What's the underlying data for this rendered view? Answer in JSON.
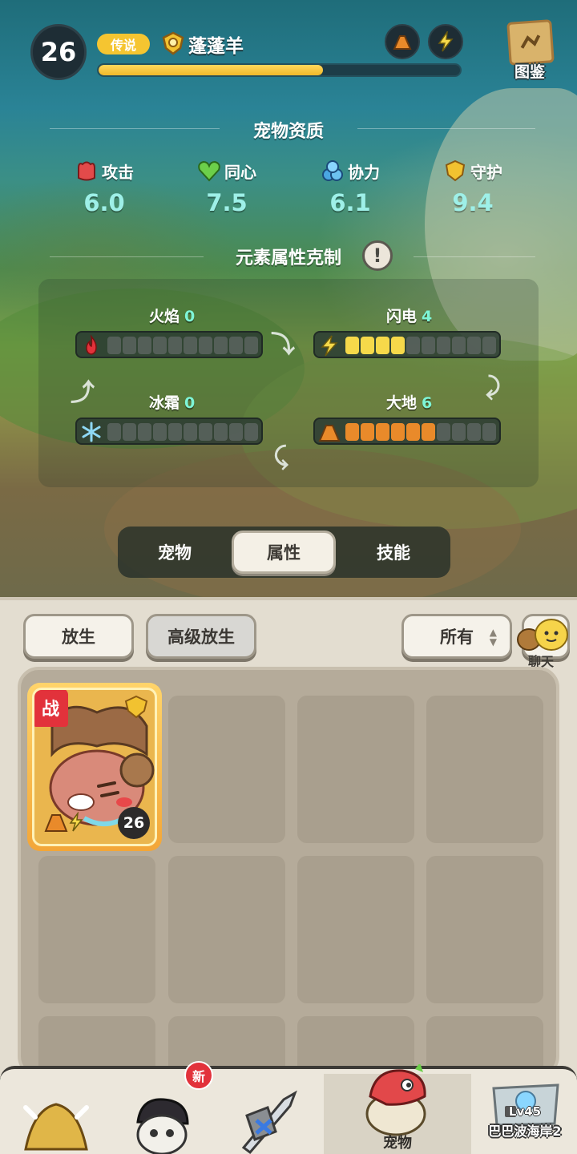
{
  "header": {
    "level": "26",
    "rarity": "传说",
    "pet_name": "蓬蓬羊",
    "exp_fraction": 0.62,
    "book_label": "图鉴",
    "element_icons": [
      "earth-icon",
      "lightning-icon"
    ]
  },
  "aptitude": {
    "title": "宠物资质",
    "stats": [
      {
        "label": "攻击",
        "value": "6.0",
        "icon": "attack-icon",
        "color": "#e24a4a"
      },
      {
        "label": "同心",
        "value": "7.5",
        "icon": "heart-icon",
        "color": "#6ccf4a"
      },
      {
        "label": "协力",
        "value": "6.1",
        "icon": "teamwork-icon",
        "color": "#4aa6e2"
      },
      {
        "label": "守护",
        "value": "9.4",
        "icon": "guard-icon",
        "color": "#f2c230"
      }
    ]
  },
  "elements": {
    "title": "元素属性克制",
    "items": [
      {
        "label": "火焰",
        "value": "0",
        "filled": 0,
        "total": 10,
        "color": "#e2323b",
        "icon": "fire-icon"
      },
      {
        "label": "闪电",
        "value": "4",
        "filled": 4,
        "total": 10,
        "color": "#f6d94a",
        "icon": "lightning-icon"
      },
      {
        "label": "冰霜",
        "value": "0",
        "filled": 0,
        "total": 10,
        "color": "#8fd8f5",
        "icon": "frost-icon"
      },
      {
        "label": "大地",
        "value": "6",
        "filled": 6,
        "total": 10,
        "color": "#e98a2a",
        "icon": "earth-icon"
      }
    ]
  },
  "tabs": [
    {
      "label": "宠物",
      "active": false
    },
    {
      "label": "属性",
      "active": true
    },
    {
      "label": "技能",
      "active": false
    }
  ],
  "inventory": {
    "release_label": "放生",
    "advanced_release_label": "高级放生",
    "filter_label": "所有",
    "chat_label": "聊天",
    "card": {
      "battle_label": "战",
      "level": "26"
    }
  },
  "bottom_nav": {
    "active_label": "宠物",
    "new_badge": "新",
    "lock_level": "Lv45",
    "map_name": "巴巴波海岸2"
  }
}
